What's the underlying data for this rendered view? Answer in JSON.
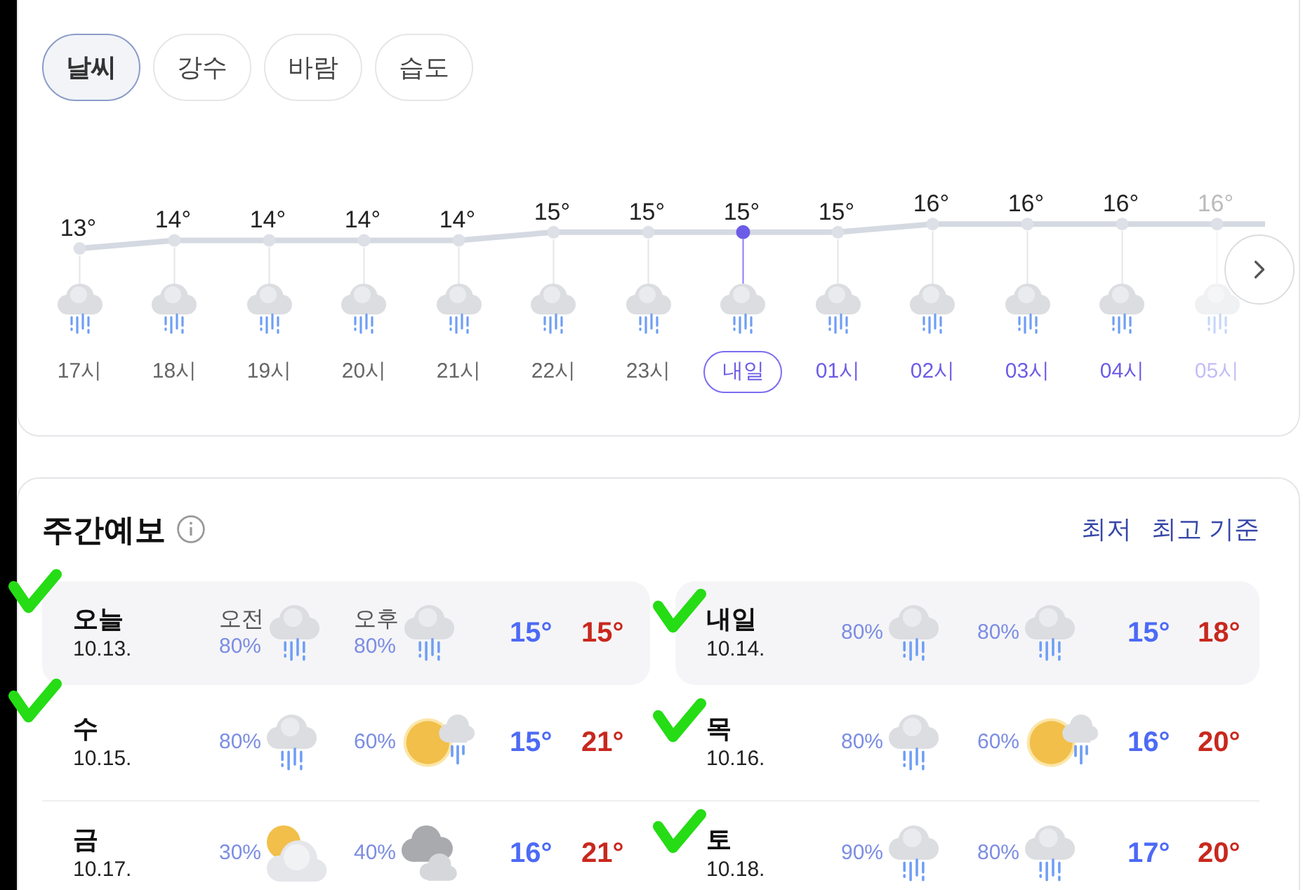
{
  "tabs": [
    {
      "label": "날씨",
      "selected": true
    },
    {
      "label": "강수",
      "selected": false
    },
    {
      "label": "바람",
      "selected": false
    },
    {
      "label": "습도",
      "selected": false
    }
  ],
  "hourly": {
    "chart_data": {
      "type": "line",
      "categories": [
        "17시",
        "18시",
        "19시",
        "20시",
        "21시",
        "22시",
        "23시",
        "내일",
        "01시",
        "02시",
        "03시",
        "04시",
        "05시"
      ],
      "series": [
        {
          "color": "#d5d9e1",
          "marker": true,
          "values": [
            13,
            14,
            14,
            14,
            14,
            15,
            15,
            15,
            15,
            16,
            16,
            16,
            16
          ]
        }
      ],
      "grid": true,
      "data_labels": true
    },
    "hours": [
      {
        "kind": "rain",
        "unit": "°",
        "selected": false,
        "next_day": false
      },
      {
        "kind": "rain",
        "unit": "°",
        "selected": false,
        "next_day": false
      },
      {
        "kind": "rain",
        "unit": "°",
        "selected": false,
        "next_day": false
      },
      {
        "kind": "rain",
        "unit": "°",
        "selected": false,
        "next_day": false
      },
      {
        "kind": "rain",
        "unit": "°",
        "selected": false,
        "next_day": false
      },
      {
        "kind": "rain",
        "unit": "°",
        "selected": false,
        "next_day": false
      },
      {
        "kind": "rain",
        "unit": "°",
        "selected": false,
        "next_day": false
      },
      {
        "kind": "rain",
        "unit": "°",
        "selected": true,
        "next_day": true
      },
      {
        "kind": "rain",
        "unit": "°",
        "selected": false,
        "next_day": true
      },
      {
        "kind": "rain",
        "unit": "°",
        "selected": false,
        "next_day": true
      },
      {
        "kind": "rain",
        "unit": "°",
        "selected": false,
        "next_day": true
      },
      {
        "kind": "rain",
        "unit": "°",
        "selected": false,
        "next_day": true
      },
      {
        "kind": "rain",
        "unit": "°",
        "selected": false,
        "next_day": true
      }
    ]
  },
  "weekly": {
    "title": "주간예보",
    "legend": [
      "최저",
      "최고 기준"
    ],
    "days": [
      {
        "day": "오늘",
        "date": "10.13.",
        "highlighted": true,
        "marked": true,
        "am": {
          "label": "오전",
          "chance": "80%",
          "kind": "rain"
        },
        "pm": {
          "label": "오후",
          "chance": "80%",
          "kind": "rain"
        },
        "low": "15°",
        "high": "15°"
      },
      {
        "day": "내일",
        "date": "10.14.",
        "highlighted": true,
        "marked": true,
        "am": {
          "chance": "80%",
          "kind": "rain"
        },
        "pm": {
          "chance": "80%",
          "kind": "rain"
        },
        "low": "15°",
        "high": "18°"
      },
      {
        "day": "수",
        "date": "10.15.",
        "highlighted": false,
        "marked": true,
        "am": {
          "chance": "80%",
          "kind": "rain"
        },
        "pm": {
          "chance": "60%",
          "kind": "sun_rain"
        },
        "low": "15°",
        "high": "21°"
      },
      {
        "day": "목",
        "date": "10.16.",
        "highlighted": false,
        "marked": true,
        "am": {
          "chance": "80%",
          "kind": "rain"
        },
        "pm": {
          "chance": "60%",
          "kind": "sun_rain"
        },
        "low": "16°",
        "high": "20°"
      },
      {
        "day": "금",
        "date": "10.17.",
        "highlighted": false,
        "marked": false,
        "am": {
          "chance": "30%",
          "kind": "sun_cloud"
        },
        "pm": {
          "chance": "40%",
          "kind": "cloudy"
        },
        "low": "16°",
        "high": "21°"
      },
      {
        "day": "토",
        "date": "10.18.",
        "highlighted": false,
        "marked": true,
        "am": {
          "chance": "90%",
          "kind": "rain"
        },
        "pm": {
          "chance": "80%",
          "kind": "rain"
        },
        "low": "17°",
        "high": "20°"
      }
    ]
  }
}
